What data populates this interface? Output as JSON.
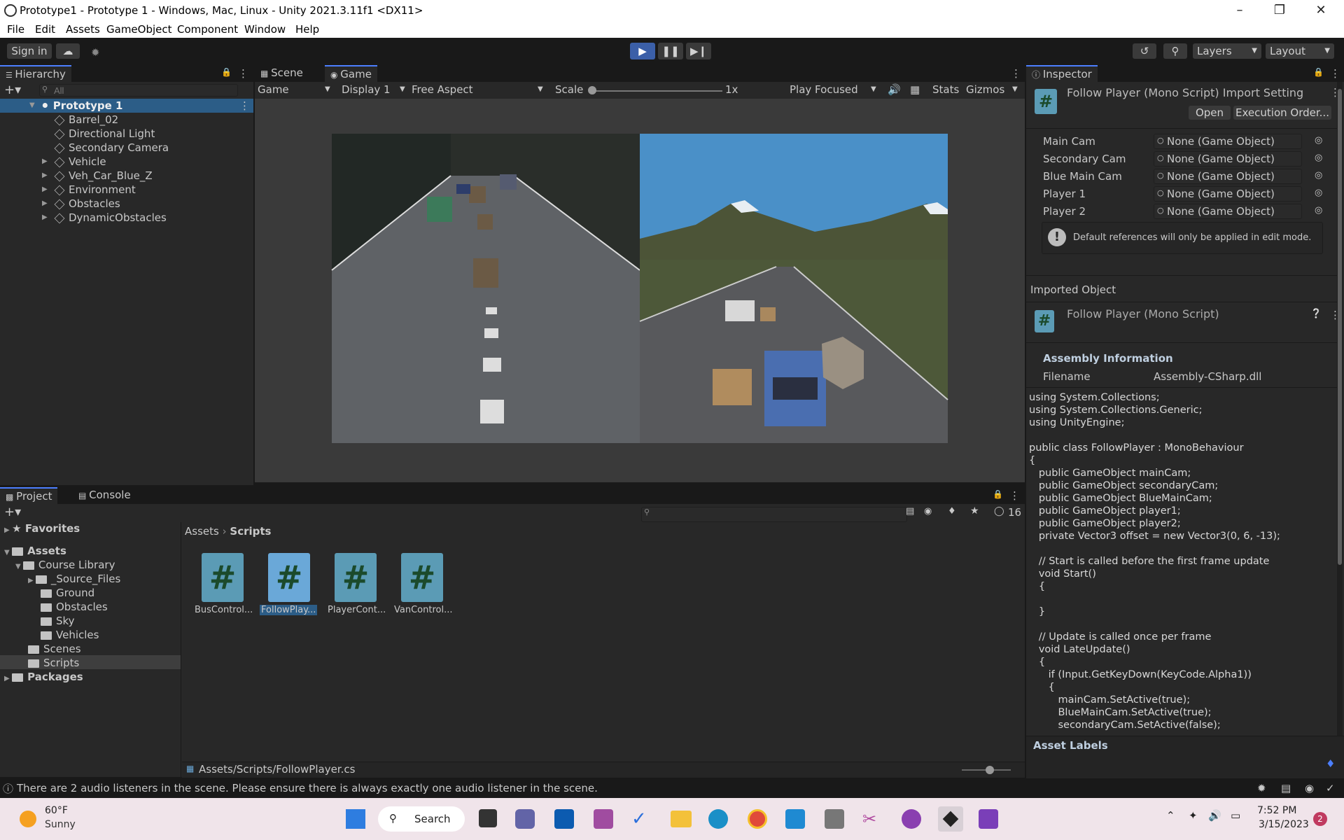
{
  "window": {
    "title": "Prototype1 - Prototype 1 - Windows, Mac, Linux - Unity 2021.3.11f1 <DX11>"
  },
  "menu": [
    "File",
    "Edit",
    "Assets",
    "GameObject",
    "Component",
    "Window",
    "Help"
  ],
  "toolbar": {
    "sign_in": "Sign in",
    "layers": "Layers",
    "layout": "Layout"
  },
  "hierarchy": {
    "tab": "Hierarchy",
    "search_placeholder": "All",
    "root": "Prototype 1",
    "items": [
      "Barrel_02",
      "Directional Light",
      "Secondary Camera",
      "Vehicle",
      "Veh_Car_Blue_Z",
      "Environment",
      "Obstacles",
      "DynamicObstacles"
    ]
  },
  "game_view": {
    "tabs": [
      "Scene",
      "Game"
    ],
    "game_dropdown": "Game",
    "display": "Display 1",
    "aspect": "Free Aspect",
    "scale_label": "Scale",
    "scale_value": "1x",
    "play_mode": "Play Focused",
    "stats": "Stats",
    "gizmos": "Gizmos"
  },
  "inspector": {
    "tab": "Inspector",
    "header_title": "Follow Player (Mono Script) Import Setting",
    "open": "Open",
    "execution_order": "Execution Order...",
    "fields": [
      {
        "label": "Main Cam",
        "value": "None (Game Object)"
      },
      {
        "label": "Secondary Cam",
        "value": "None (Game Object)"
      },
      {
        "label": "Blue Main Cam",
        "value": "None (Game Object)"
      },
      {
        "label": "Player 1",
        "value": "None (Game Object)"
      },
      {
        "label": "Player 2",
        "value": "None (Game Object)"
      }
    ],
    "info": "Default references will only be applied in edit mode.",
    "imported_object": "Imported Object",
    "imported_title": "Follow Player (Mono Script)",
    "assembly_info": "Assembly Information",
    "filename_label": "Filename",
    "filename_value": "Assembly-CSharp.dll",
    "code": "using System.Collections;\nusing System.Collections.Generic;\nusing UnityEngine;\n\npublic class FollowPlayer : MonoBehaviour\n{\n   public GameObject mainCam;\n   public GameObject secondaryCam;\n   public GameObject BlueMainCam;\n   public GameObject player1;\n   public GameObject player2;\n   private Vector3 offset = new Vector3(0, 6, -13);\n\n   // Start is called before the first frame update\n   void Start()\n   {\n\n   }\n\n   // Update is called once per frame\n   void LateUpdate()\n   {\n      if (Input.GetKeyDown(KeyCode.Alpha1))\n      {\n         mainCam.SetActive(true);\n         BlueMainCam.SetActive(true);\n         secondaryCam.SetActive(false);",
    "asset_labels": "Asset Labels"
  },
  "project": {
    "tabs": [
      "Project",
      "Console"
    ],
    "hidden_count": "16",
    "favorites": "Favorites",
    "assets": "Assets",
    "course_library": "Course Library",
    "course_children": [
      "_Source_Files",
      "Ground",
      "Obstacles",
      "Sky",
      "Vehicles"
    ],
    "scenes": "Scenes",
    "scripts": "Scripts",
    "packages": "Packages",
    "breadcrumb": [
      "Assets",
      "Scripts"
    ],
    "files": [
      "BusControl...",
      "FollowPlay...",
      "PlayerCont...",
      "VanControl..."
    ],
    "path": "Assets/Scripts/FollowPlayer.cs"
  },
  "status": "There are 2 audio listeners in the scene. Please ensure there is always exactly one audio listener in the scene.",
  "taskbar": {
    "temp": "60°F",
    "weather": "Sunny",
    "search": "Search",
    "time": "7:52 PM",
    "date": "3/15/2023",
    "badge": "2"
  },
  "colors": {
    "accent": "#4c7fff",
    "panel": "#282828",
    "bg": "#191919",
    "sky": "#4a90c8"
  }
}
